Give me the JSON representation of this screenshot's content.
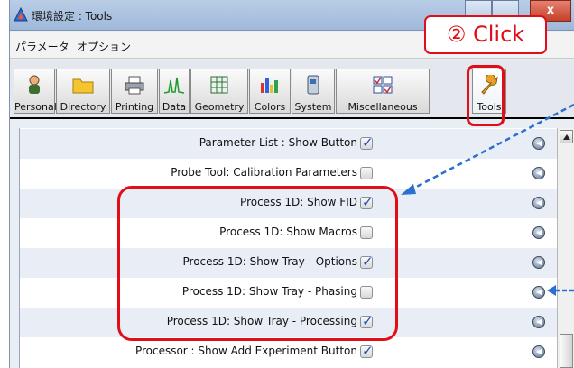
{
  "window": {
    "title": "環境設定 : Tools"
  },
  "menu": [
    "パラメータ",
    "オプション"
  ],
  "toolbar": [
    {
      "label": "Personal",
      "icon": "person-icon"
    },
    {
      "label": "Directory",
      "icon": "folder-icon"
    },
    {
      "label": "Printing",
      "icon": "printer-icon"
    },
    {
      "label": "Data",
      "icon": "spectrum-icon"
    },
    {
      "label": "Geometry",
      "icon": "grid-icon"
    },
    {
      "label": "Colors",
      "icon": "palette-icon"
    },
    {
      "label": "System",
      "icon": "system-icon"
    },
    {
      "label": "Miscellaneous",
      "icon": "checklist-icon"
    },
    {
      "label": "Tools",
      "icon": "wrench-icon",
      "selected": true
    }
  ],
  "annotation": {
    "callout_text": "② Click",
    "accent_color": "#e10e18",
    "arrow_color": "#2b6fd0"
  },
  "settings": [
    {
      "label": "Parameter List : Show Button",
      "checked": true
    },
    {
      "label": "Probe Tool: Calibration Parameters",
      "checked": false
    },
    {
      "label": "Process 1D: Show FID",
      "checked": true
    },
    {
      "label": "Process 1D: Show Macros",
      "checked": false
    },
    {
      "label": "Process 1D: Show Tray - Options",
      "checked": true
    },
    {
      "label": "Process 1D: Show Tray - Phasing",
      "checked": false
    },
    {
      "label": "Process 1D: Show Tray - Processing",
      "checked": true
    },
    {
      "label": "Processor : Show Add Experiment Button",
      "checked": true
    }
  ]
}
